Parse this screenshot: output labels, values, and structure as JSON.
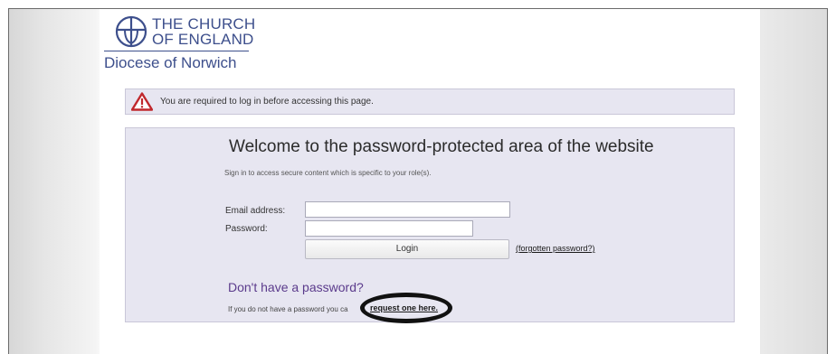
{
  "logo": {
    "line1": "THE CHURCH",
    "line2": "OF ENGLAND",
    "diocese": "Diocese of Norwich",
    "color": "#3d4f8c"
  },
  "alert": {
    "icon": "warning-triangle-icon",
    "message": "You are required to log in before accessing this page."
  },
  "login": {
    "title": "Welcome to the password-protected area of the website",
    "subtitle": "Sign in to access secure content which is specific to your role(s).",
    "email_label": "Email address:",
    "email_value": "",
    "password_label": "Password:",
    "password_value": "",
    "login_button": "Login",
    "forgot_link": "(forgotten password?)"
  },
  "no_password": {
    "heading": "Don't have a password?",
    "text": "If you do not have a password you ca",
    "link": "request one here."
  },
  "colors": {
    "panel_bg": "#e7e6f1",
    "heading_purple": "#5b3b8c",
    "warning_red": "#c0282d"
  }
}
